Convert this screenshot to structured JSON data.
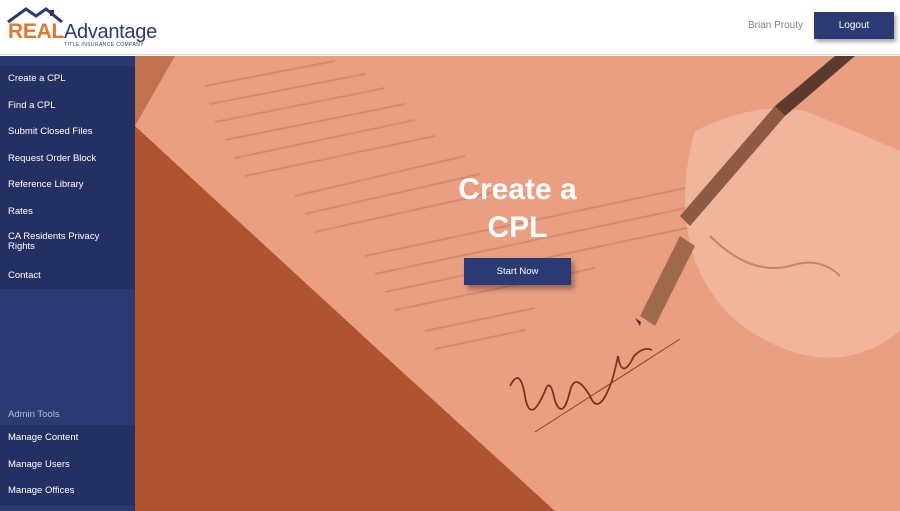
{
  "header": {
    "logo": {
      "real": "REAL",
      "advantage": "Advantage",
      "tagline": "TITLE INSURANCE COMPANY"
    },
    "user_name": "Brian Prouty",
    "logout_label": "Logout"
  },
  "sidebar": {
    "items": [
      {
        "label": "Create a CPL"
      },
      {
        "label": "Find a CPL"
      },
      {
        "label": "Submit Closed Files"
      },
      {
        "label": "Request Order Block"
      },
      {
        "label": "Reference Library"
      },
      {
        "label": "Rates"
      },
      {
        "label": "CA Residents Privacy Rights"
      },
      {
        "label": "Contact"
      }
    ],
    "admin_label": "Admin Tools",
    "admin_items": [
      {
        "label": "Manage Content"
      },
      {
        "label": "Manage Users"
      },
      {
        "label": "Manage Offices"
      }
    ]
  },
  "hero": {
    "title": "Create a CPL",
    "button_label": "Start Now"
  },
  "colors": {
    "brand_navy": "#2b3a73",
    "brand_orange": "#e0772f",
    "hero_overlay": "#e2987a"
  }
}
